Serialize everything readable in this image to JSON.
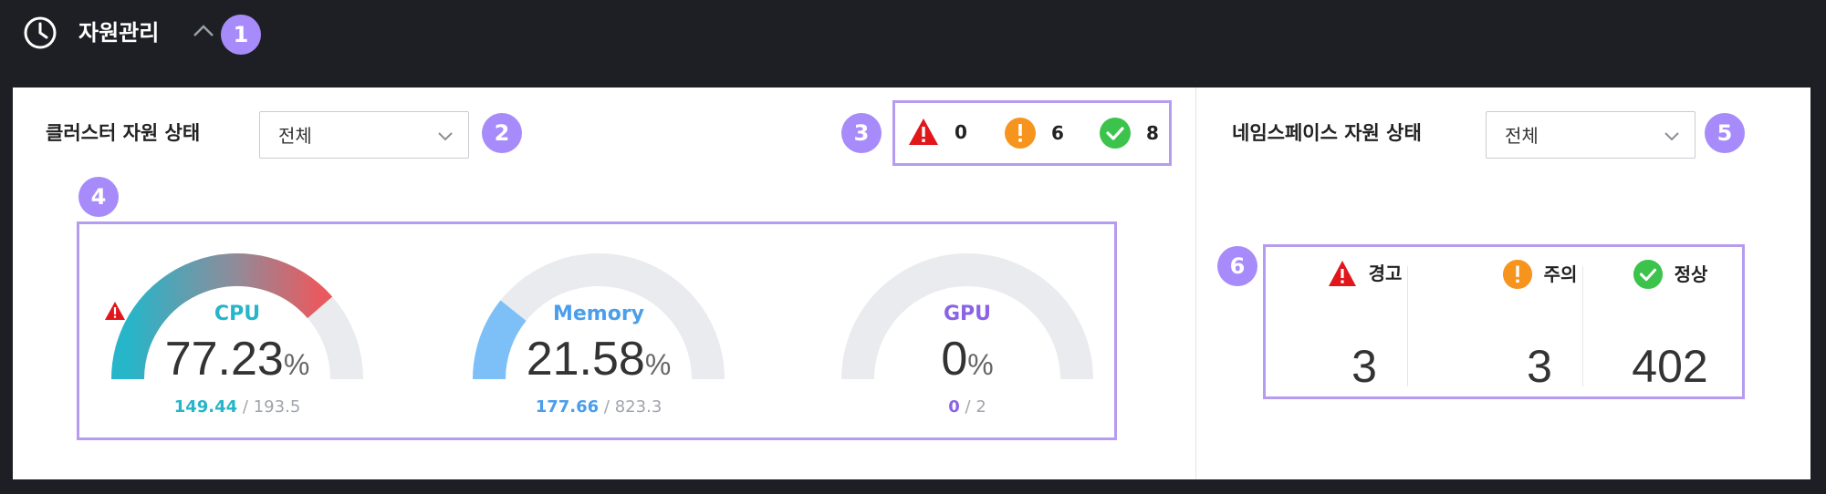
{
  "header": {
    "title": "자원관리",
    "collapse_icon": "chevron-up-icon",
    "icon": "clock-icon"
  },
  "callouts": [
    "1",
    "2",
    "3",
    "4",
    "5",
    "6"
  ],
  "cluster": {
    "title": "클러스터 자원 상태",
    "filter": {
      "value": "전체"
    },
    "status_counts": {
      "warning": "0",
      "caution": "6",
      "normal": "8"
    },
    "gauges": [
      {
        "name": "CPU",
        "alert": true,
        "percent": 77.23,
        "value": "77.23",
        "unit": "%",
        "used": "149.44",
        "total": "193.5",
        "color": "#26b5c9"
      },
      {
        "name": "Memory",
        "alert": false,
        "percent": 21.58,
        "value": "21.58",
        "unit": "%",
        "used": "177.66",
        "total": "823.3",
        "color": "#4a9eeb"
      },
      {
        "name": "GPU",
        "alert": false,
        "percent": 0,
        "value": "0",
        "unit": "%",
        "used": "0",
        "total": "2",
        "color": "#8a63e6"
      }
    ]
  },
  "namespace": {
    "title": "네임스페이스 자원 상태",
    "filter": {
      "value": "전체"
    },
    "summary": [
      {
        "label": "경고",
        "value": "3",
        "icon": "warning-icon"
      },
      {
        "label": "주의",
        "value": "3",
        "icon": "caution-icon"
      },
      {
        "label": "정상",
        "value": "402",
        "icon": "check-icon"
      }
    ]
  },
  "colors": {
    "warning": "#e0161b",
    "caution": "#f7941d",
    "normal": "#3cc34c",
    "accent": "#a78bfa",
    "track": "#e9ebee"
  },
  "separator": "/"
}
